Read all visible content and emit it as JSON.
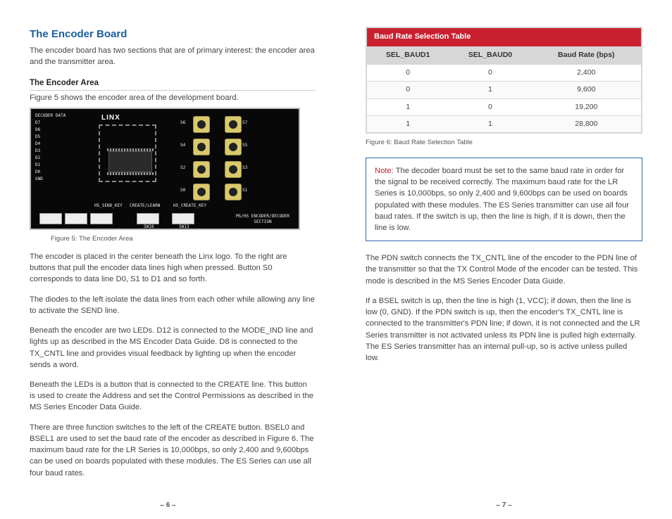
{
  "left": {
    "title": "The Encoder Board",
    "intro": "The encoder board has two sections that are of primary interest: the encoder area and the transmitter area.",
    "area_heading": "The Encoder Area",
    "fig5_intro": "Figure 5 shows the encoder area of the development board.",
    "fig5_caption": "Figure 5: The Encoder Area",
    "p1": "The encoder is placed in the center beneath the Linx logo. To the right are buttons that pull the encoder data lines high when pressed. Button S0 corresponds to data line D0, S1 to D1 and so forth.",
    "p2": "The diodes to the left isolate the data lines from each other while allowing any line to activate the SEND line.",
    "p3": "Beneath the encoder are two LEDs. D12 is connected to the MODE_IND line and lights up as described in the MS Encoder Data Guide. D8 is connected to the TX_CNTL line and provides visual feedback by lighting up when the encoder sends a word.",
    "p4": "Beneath the LEDs is a button that is connected to the CREATE line. This button is used to create the Address and set the Control Permissions as described in the MS Series Encoder Data Guide.",
    "p5": "There are three function switches to the left of the CREATE button. BSEL0 and BSEL1 are used to set the baud rate of the encoder as described in Figure 6. The maximum baud rate for the LR Series is 10,000bps, so only 2,400 and 9,600bps can be used on boards populated with these modules. The ES Series can use all four baud rates.",
    "board_logo": "LINX",
    "board_section_label": "MS/HS ENCODER/DECODER SECTION",
    "page_num": "– 6 –"
  },
  "right": {
    "table_title": "Baud Rate Selection Table",
    "columns": [
      "SEL_BAUD1",
      "SEL_BAUD0",
      "Baud Rate (bps)"
    ],
    "fig6_caption": "Figure 6: Baud Rate Selection Table",
    "note_label": "Note:",
    "note_body": " The decoder board must be set to the same baud rate in order for the signal to be received correctly. The maximum baud rate for the LR Series is 10,000bps, so only 2,400 and 9,600bps can be used on boards populated with these modules. The ES Series transmitter can use all four baud rates. If the switch is up, then the line is high, if it is down, then the line is low.",
    "p1": "The PDN switch connects the TX_CNTL line of the encoder to the PDN line of the transmitter so that the TX Control Mode of the encoder can be tested. This mode is described in the MS Series Encoder Data Guide.",
    "p2": "If a BSEL switch is up, then the line is high (1, VCC); if down, then the line is low (0, GND). If the PDN switch is up, then the encoder's TX_CNTL line is connected to the transmitter's PDN line; if down, it is not connected and the LR Series transmitter is not activated unless its PDN line is pulled high externally. The ES Series transmitter has an internal pull-up, so is active unless pulled low.",
    "page_num": "– 7 –"
  },
  "chart_data": {
    "type": "table",
    "title": "Baud Rate Selection Table",
    "columns": [
      "SEL_BAUD1",
      "SEL_BAUD0",
      "Baud Rate (bps)"
    ],
    "rows": [
      [
        "0",
        "0",
        "2,400"
      ],
      [
        "0",
        "1",
        "9,600"
      ],
      [
        "1",
        "0",
        "19,200"
      ],
      [
        "1",
        "1",
        "28,800"
      ]
    ]
  }
}
